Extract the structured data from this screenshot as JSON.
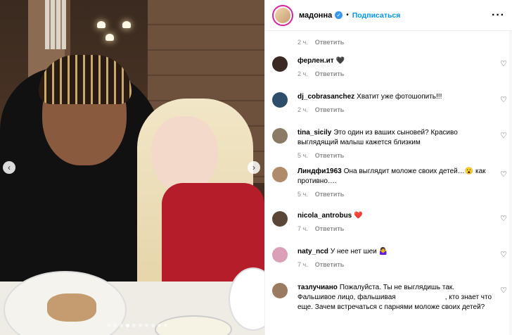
{
  "post": {
    "author": "мадонна",
    "verified_mark": "✓",
    "separator": "•",
    "follow_label": "Подписаться",
    "more": "···",
    "top_time": "2 ч.",
    "reply_label": "Ответить"
  },
  "photo": {
    "prev_arrow": "‹",
    "next_arrow": "›",
    "slide_count": 10,
    "active_slide": 3
  },
  "comments": [
    {
      "user": "ферлен.ит",
      "text": "🖤",
      "time": "2 ч.",
      "avatar_color": "#3b2a24"
    },
    {
      "user": "dj_cobrasanchez",
      "text": "Хватит уже фотошопить!!!",
      "time": "2 ч.",
      "avatar_color": "#2d4d6b"
    },
    {
      "user": "tina_sicily",
      "text": "Это один из ваших сыновей? Красиво выглядящий малыш кажется близким",
      "time": "5 ч.",
      "avatar_color": "#8a7a66"
    },
    {
      "user": "Линдфи1963",
      "text": "Она выглядит моложе своих детей…😮 как противно….",
      "time": "5 ч.",
      "avatar_color": "#b08b6a"
    },
    {
      "user": "nicola_antrobus",
      "text": "❤️",
      "time": "7 ч.",
      "avatar_color": "#5a4636"
    },
    {
      "user": "naty_ncd",
      "text": "У нее нет шеи 🤷‍♀️",
      "time": "7 ч.",
      "avatar_color": "#d9a0b8"
    },
    {
      "user": "тазлучиано",
      "text": "Пожалуйста. Ты не выглядишь так. Фальшивое лицо, фальшивая",
      "text_after": ", кто знает что еще. Зачем встречаться с парнями моложе своих детей?",
      "time": "",
      "avatar_color": "#9a7a60"
    }
  ],
  "icons": {
    "heart": "♡",
    "verified": "verified-badge-icon"
  }
}
